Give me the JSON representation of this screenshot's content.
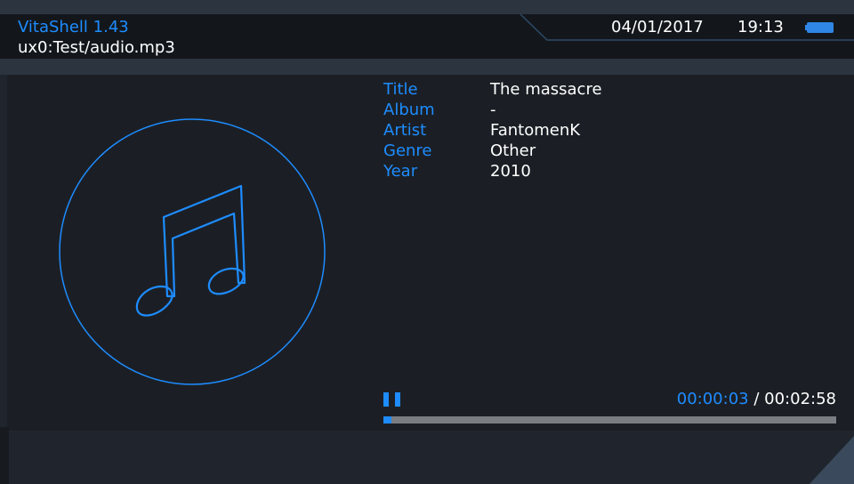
{
  "header": {
    "app_title": "VitaShell 1.43",
    "path": "ux0:Test/audio.mp3",
    "date": "04/01/2017",
    "time": "19:13"
  },
  "colors": {
    "accent": "#1e8cff",
    "background": "#1a1e24",
    "progress_track": "#7a7d82"
  },
  "album_art": {
    "icon": "music-note-icon"
  },
  "metadata": {
    "title": {
      "label": "Title",
      "value": "The massacre"
    },
    "album": {
      "label": "Album",
      "value": "-"
    },
    "artist": {
      "label": "Artist",
      "value": "FantomenK"
    },
    "genre": {
      "label": "Genre",
      "value": "Other"
    },
    "year": {
      "label": "Year",
      "value": "2010"
    }
  },
  "player": {
    "state_icon": "pause-icon",
    "current_time": "00:00:03",
    "separator": "/",
    "total_time": "00:02:58",
    "progress_fraction": 0.017
  }
}
